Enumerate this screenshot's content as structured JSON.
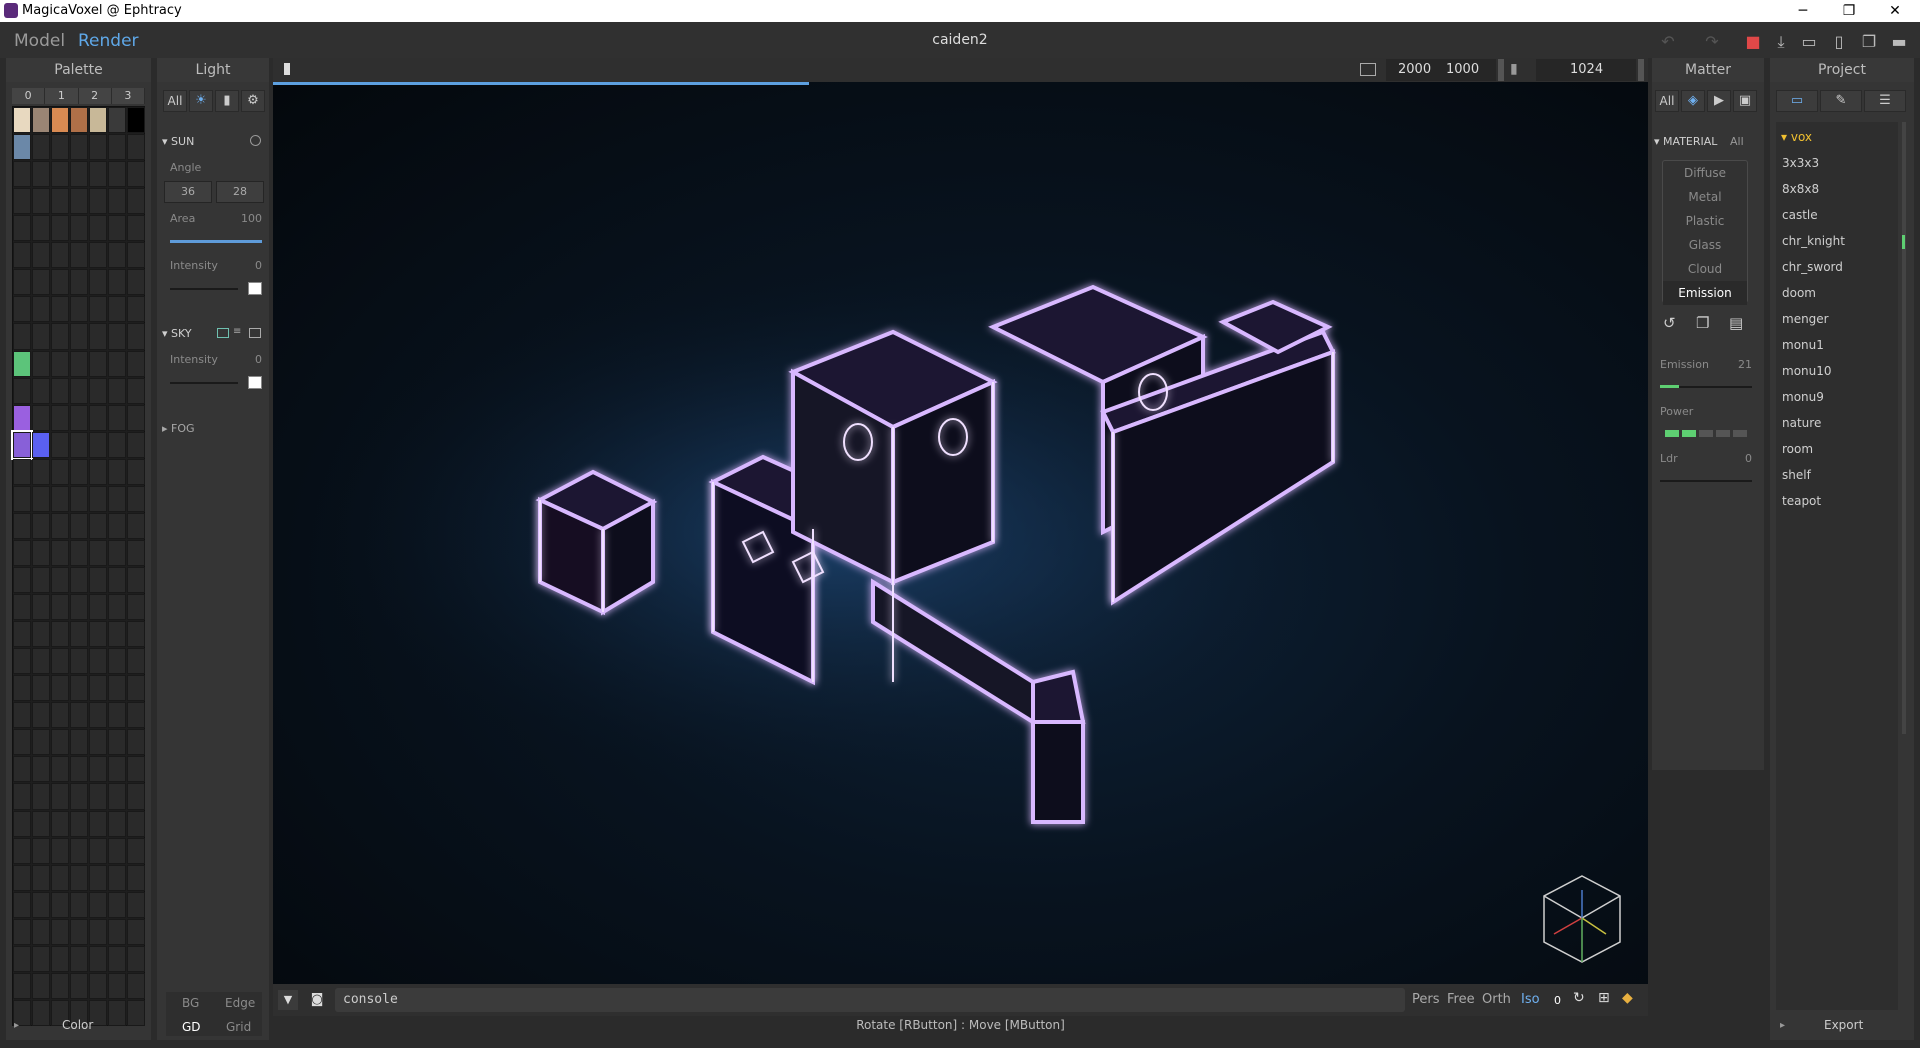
{
  "window": {
    "title": "MagicaVoxel @ Ephtracy",
    "minimize": "─",
    "maximize": "❐",
    "close": "✕"
  },
  "menu": {
    "model": "Model",
    "render": "Render",
    "file_title": "caiden2"
  },
  "palette": {
    "header": "Palette",
    "tabs": [
      "0",
      "1",
      "2",
      "3"
    ],
    "footer": "Color",
    "colors": [
      "#e8d9c0",
      "#9a8574",
      "#d88a52",
      "#b07048",
      "#c8b898",
      "#3a3a3a",
      "#000000",
      "#6b88a8",
      "#5cc47a",
      "#9a60e0",
      "#8860d8",
      "#5a60f0"
    ]
  },
  "light": {
    "header": "Light",
    "filter_all": "All",
    "sun": {
      "title": "SUN",
      "angle_label": "Angle",
      "angle_a": "36",
      "angle_b": "28",
      "area_label": "Area",
      "area_value": "100",
      "intensity_label": "Intensity",
      "intensity_value": "0"
    },
    "sky": {
      "title": "SKY",
      "intensity_label": "Intensity",
      "intensity_value": "0"
    },
    "fog": {
      "title": "FOG"
    },
    "footer": {
      "bg": "BG",
      "edge": "Edge",
      "gd": "GD",
      "grid": "Grid"
    }
  },
  "render": {
    "width": "2000",
    "height": "1000",
    "samples": "1024",
    "progress": 0.39
  },
  "matter": {
    "header": "Matter",
    "filter_all": "All",
    "material_title": "MATERIAL",
    "material_all": "All",
    "materials": [
      "Diffuse",
      "Metal",
      "Plastic",
      "Glass",
      "Cloud",
      "Emission"
    ],
    "selected": "Emission",
    "emission_label": "Emission",
    "emission_value": "21",
    "power_label": "Power",
    "ldr_label": "Ldr",
    "ldr_value": "0"
  },
  "project": {
    "header": "Project",
    "folder": "vox",
    "files": [
      "3x3x3",
      "8x8x8",
      "castle",
      "chr_knight",
      "chr_sword",
      "doom",
      "menger",
      "monu1",
      "monu10",
      "monu9",
      "nature",
      "room",
      "shelf",
      "teapot"
    ],
    "export": "Export"
  },
  "bottom": {
    "console": "console",
    "pers": "Pers",
    "free": "Free",
    "orth": "Orth",
    "iso": "Iso",
    "zero": "0"
  },
  "status": "Rotate [RButton] : Move [MButton]"
}
